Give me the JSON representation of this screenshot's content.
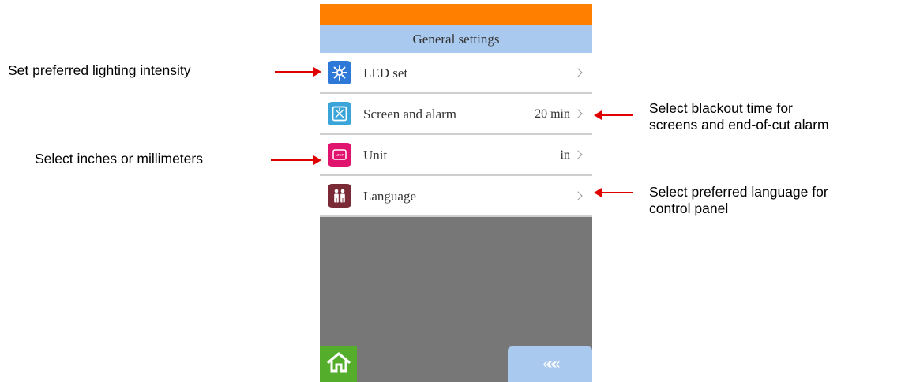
{
  "screen": {
    "title": "General settings",
    "items": [
      {
        "label": "LED set",
        "value": "",
        "icon": "sun-icon"
      },
      {
        "label": "Screen and alarm",
        "value": "20 min",
        "icon": "screen-icon"
      },
      {
        "label": "Unit",
        "value": "in",
        "icon": "unit-icon",
        "icon_text": "UNIT"
      },
      {
        "label": "Language",
        "value": "",
        "icon": "people-icon"
      }
    ],
    "home_icon": "home-icon",
    "back_label": "«««"
  },
  "annotations": {
    "led": "Set preferred lighting intensity",
    "unit": "Select inches or millimeters",
    "screen_line1": "Select blackout time for",
    "screen_line2": "screens and end-of-cut alarm",
    "language_line1": "Select preferred language for",
    "language_line2": "control panel"
  },
  "colors": {
    "header_orange": "#ff7f00",
    "title_blue": "#a9c9ee",
    "background_gray": "#777777",
    "home_green": "#55ad2c",
    "arrow_red": "#e00000"
  }
}
